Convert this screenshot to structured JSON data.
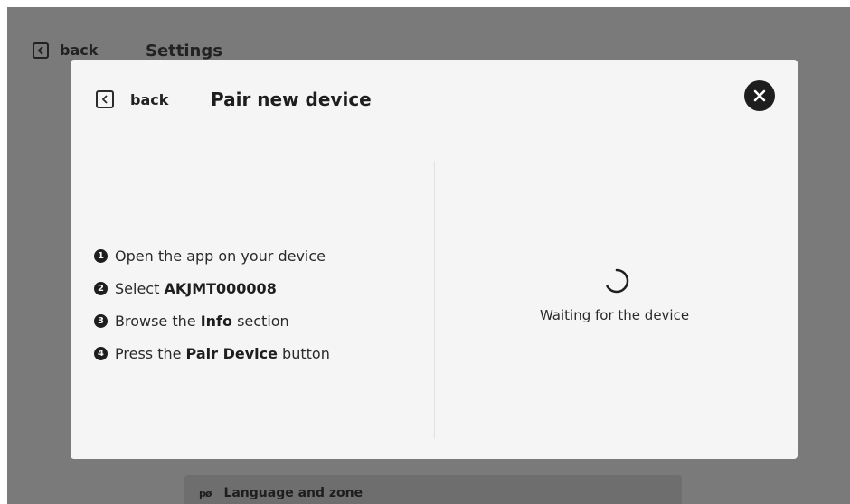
{
  "background": {
    "back_label": "back",
    "title": "Settings",
    "row": {
      "icon": "language-icon",
      "icon_glyph": "pø",
      "label": "Language and zone"
    }
  },
  "modal": {
    "back_label": "back",
    "title": "Pair new device",
    "close_icon": "close-icon",
    "steps": [
      {
        "number": "1",
        "prefix": "Open the app on your device",
        "bold": "",
        "suffix": ""
      },
      {
        "number": "2",
        "prefix": "Select ",
        "bold": "AKJMT000008",
        "suffix": ""
      },
      {
        "number": "3",
        "prefix": "Browse the ",
        "bold": "Info",
        "suffix": " section"
      },
      {
        "number": "4",
        "prefix": "Press the ",
        "bold": "Pair Device",
        "suffix": " button"
      }
    ],
    "status": {
      "icon": "loading-spinner-icon",
      "text": "Waiting for the device"
    }
  },
  "colors": {
    "overlay": "#7a7a7a",
    "modal_bg": "#f5f5f5",
    "text_primary": "#1e1e1e",
    "close_button": "#1e1e1e"
  }
}
